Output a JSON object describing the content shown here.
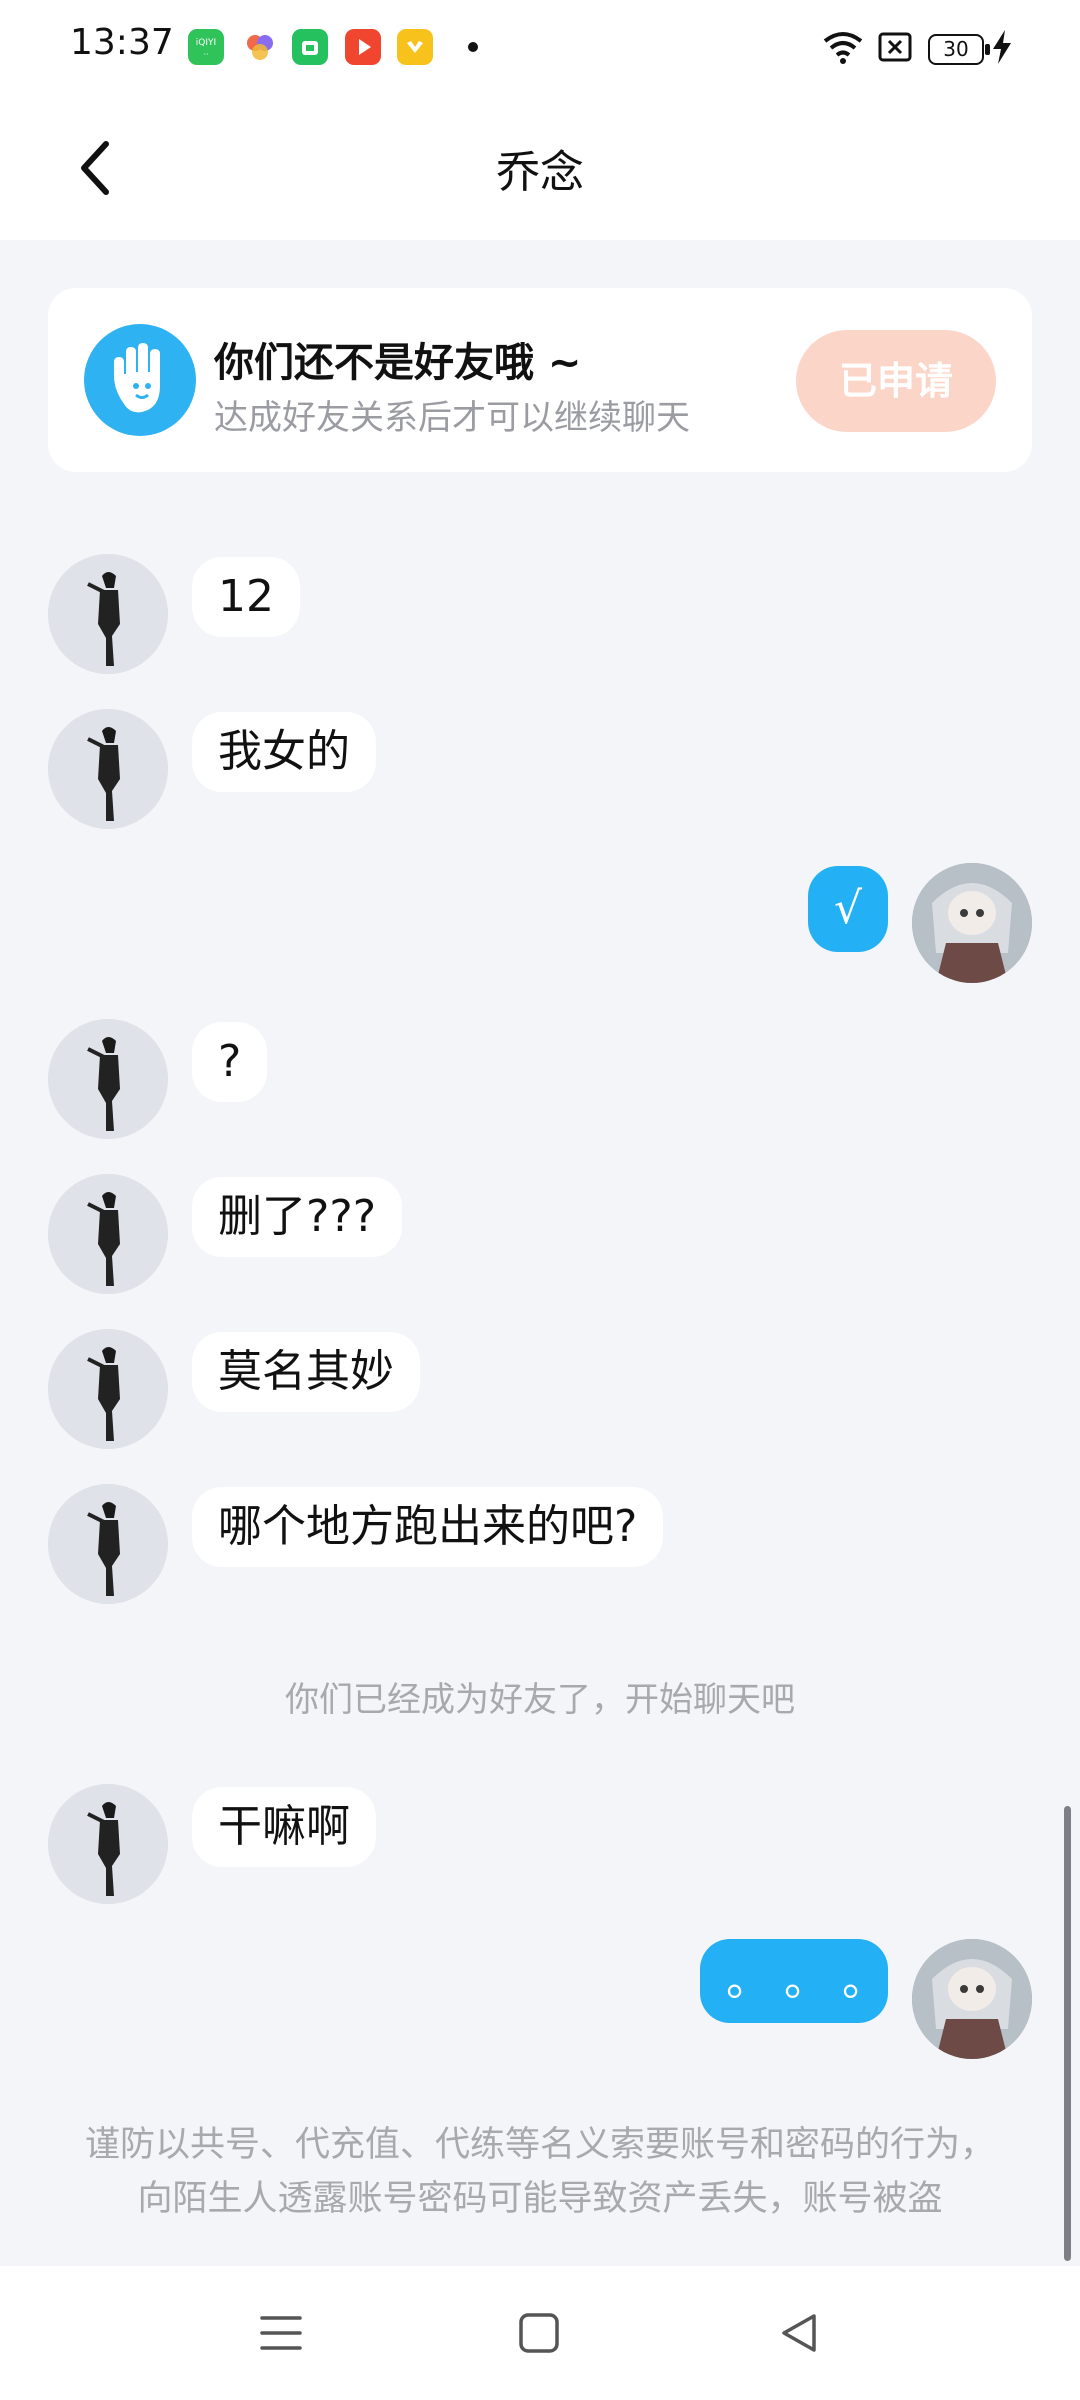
{
  "status_bar": {
    "time": "13:37",
    "battery": "30",
    "icons": [
      "iqiyi-app-icon",
      "colorful-app-icon",
      "green-shop-app-icon",
      "red-video-app-icon",
      "yellow-app-icon",
      "wifi-icon",
      "sim-off-icon",
      "battery-icon",
      "charging-icon"
    ]
  },
  "header": {
    "title": "乔念"
  },
  "notice": {
    "title": "你们还不是好友哦 ~",
    "subtitle": "达成好友关系后才可以继续聊天",
    "button": "已申请"
  },
  "messages": [
    {
      "side": "left",
      "text": "12"
    },
    {
      "side": "left",
      "text": "我女的"
    },
    {
      "side": "right",
      "text": "√"
    },
    {
      "side": "left",
      "text": "?"
    },
    {
      "side": "left",
      "text": "删了???"
    },
    {
      "side": "left",
      "text": "莫名其妙"
    },
    {
      "side": "left",
      "text": "哪个地方跑出来的吧?"
    },
    {
      "side": "left",
      "text": "干嘛啊"
    },
    {
      "side": "right",
      "text": "。 。 。"
    }
  ],
  "system_note": "你们已经成为好友了，开始聊天吧",
  "warning": "谨防以共号、代充值、代练等名义索要账号和密码的行为，向陌生人透露账号密码可能导致资产丢失，账号被盗",
  "colors": {
    "accent": "#24b0f5",
    "applied_button": "#fbd6c8",
    "background": "#f4f5f8"
  }
}
